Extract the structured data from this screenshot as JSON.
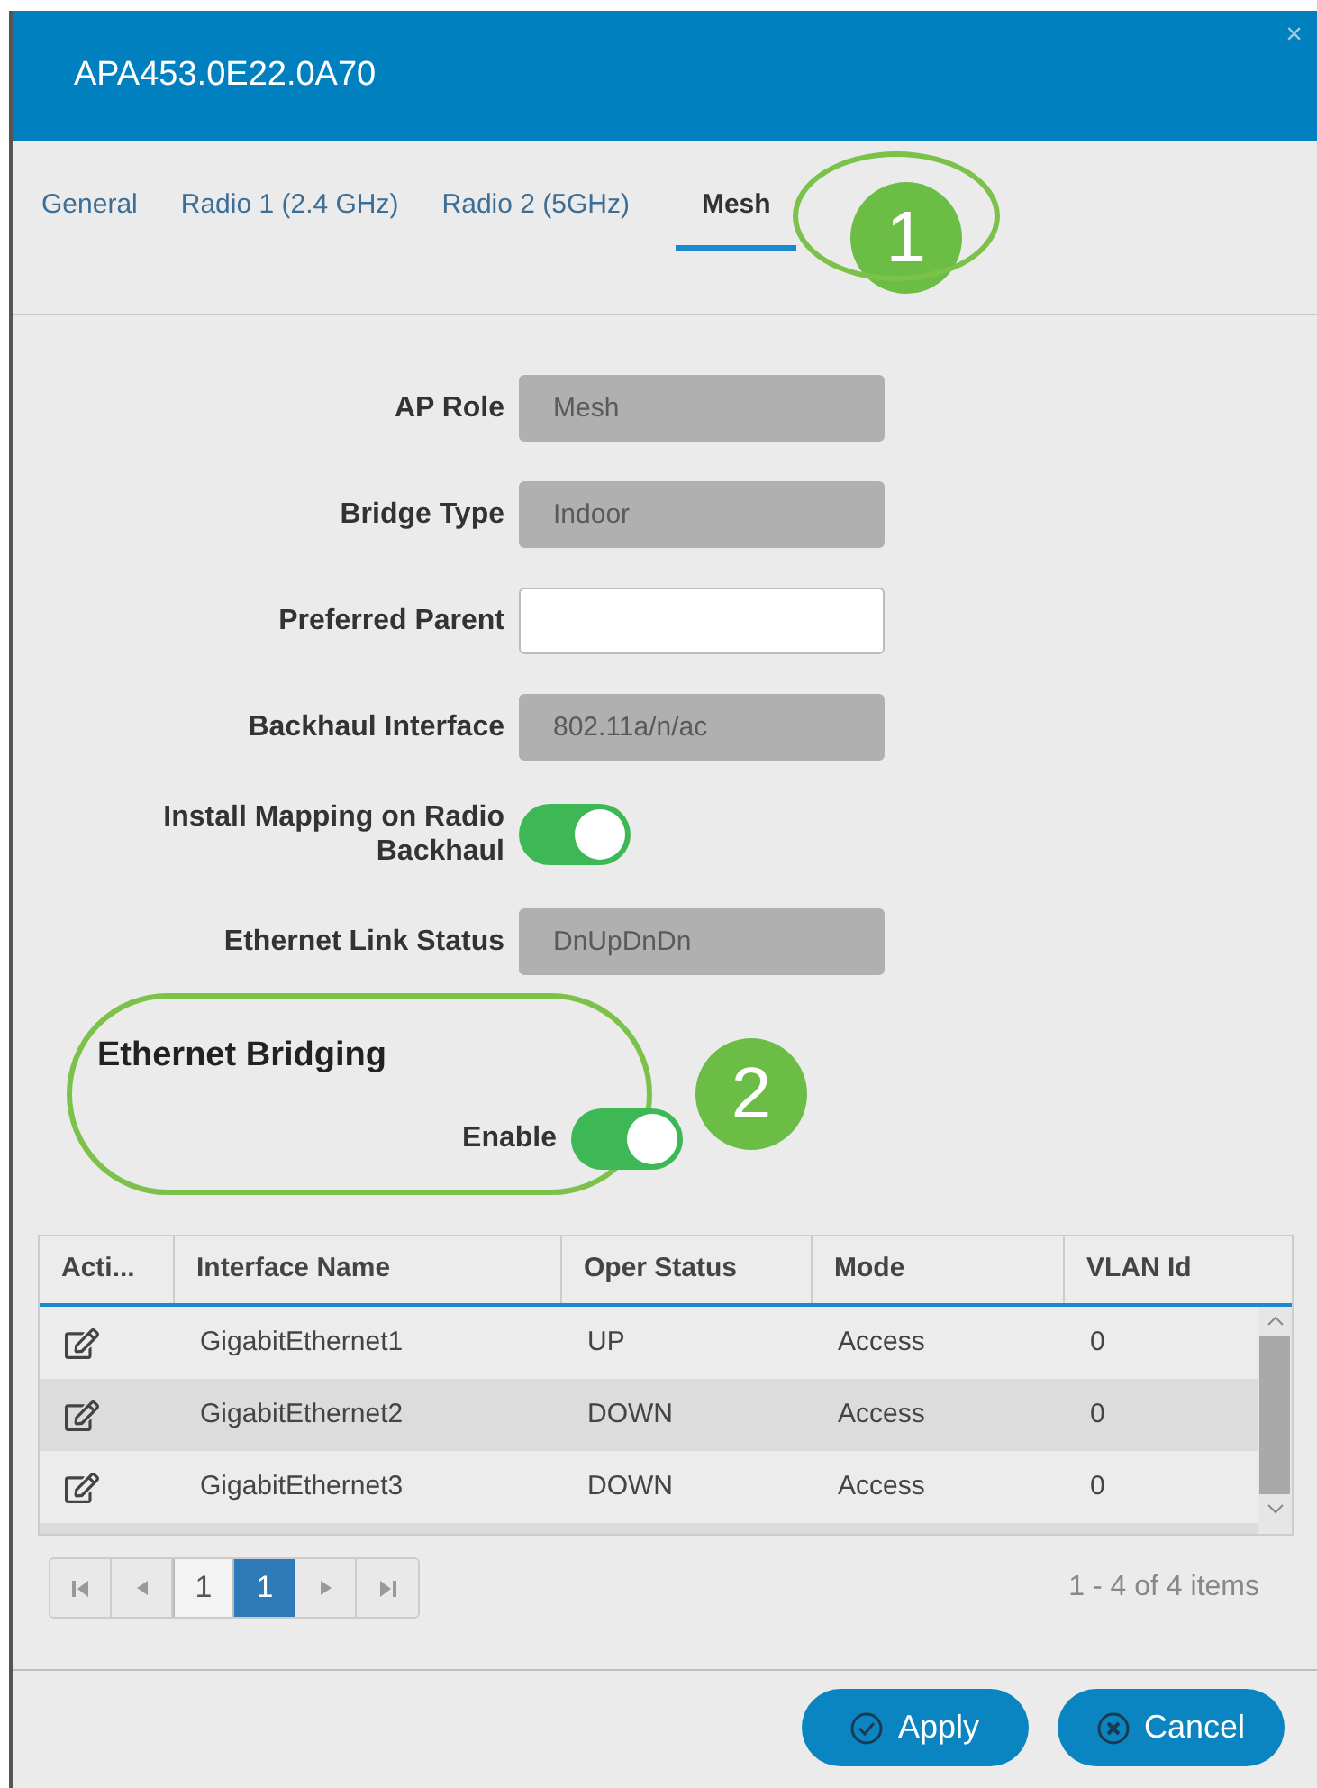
{
  "dialog": {
    "title": "APA453.0E22.0A70",
    "close": "×"
  },
  "tabs": [
    {
      "label": "General",
      "selected": false
    },
    {
      "label": "Radio 1 (2.4 GHz)",
      "selected": false
    },
    {
      "label": "Radio 2 (5GHz)",
      "selected": false
    },
    {
      "label": "Mesh",
      "selected": true
    }
  ],
  "fields": [
    {
      "kind": "field",
      "label": "AP Role",
      "value": "Mesh",
      "disabled": true
    },
    {
      "kind": "field",
      "label": "Bridge Type",
      "value": "Indoor",
      "disabled": true
    },
    {
      "kind": "field",
      "label": "Preferred Parent",
      "disabled": false
    },
    {
      "kind": "field",
      "label": "Backhaul Interface",
      "value": "802.11a/n/ac",
      "disabled": true
    },
    {
      "kind": "toggle",
      "label": "Install Mapping on Radio Backhaul",
      "on": true
    },
    {
      "kind": "field",
      "label": "Ethernet Link Status",
      "value": "DnUpDnDn",
      "disabled": true
    }
  ],
  "ethernet_bridging": {
    "title": "Ethernet Bridging",
    "label": "Enable",
    "on": true
  },
  "callouts": [
    {
      "label": "1"
    },
    {
      "label": "2"
    }
  ],
  "table": {
    "columns": [
      "Acti...",
      "Interface Name",
      "Oper Status",
      "Mode",
      "VLAN Id"
    ],
    "rows": [
      {
        "cells": [
          "",
          "GigabitEthernet1",
          "UP",
          "Access",
          "0"
        ]
      },
      {
        "cells": [
          "",
          "GigabitEthernet2",
          "DOWN",
          "Access",
          "0"
        ]
      },
      {
        "cells": [
          "",
          "GigabitEthernet3",
          "DOWN",
          "Access",
          "0"
        ]
      }
    ],
    "pager": {
      "pages": [
        {
          "label": "1",
          "selected": false
        },
        {
          "label": "1",
          "selected": true
        }
      ],
      "summary": "1 - 4 of 4 items"
    }
  },
  "buttons": [
    {
      "kind": "apply",
      "label": "Apply"
    },
    {
      "kind": "cancel",
      "label": "Cancel"
    }
  ]
}
